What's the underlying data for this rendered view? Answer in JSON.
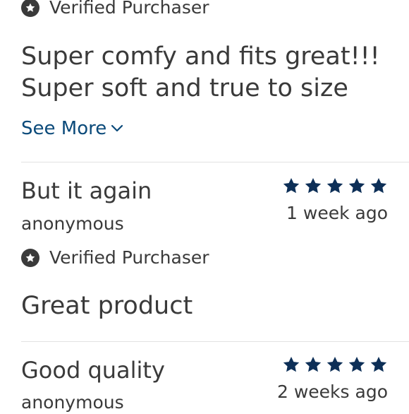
{
  "colors": {
    "text": "#3a3a3a",
    "link": "#0b4a7a",
    "star": "#0d2f57",
    "divider": "#e2e2e2"
  },
  "verified_label": "Verified Purchaser",
  "see_more_label": "See More",
  "reviews": [
    {
      "body_line1": "Super comfy and fits great!!!",
      "body_line2": "Super soft and true to size"
    },
    {
      "title": "But it again",
      "reviewer": "anonymous",
      "rating": 5,
      "date": "1 week ago",
      "body": "Great product"
    },
    {
      "title": "Good quality",
      "reviewer": "anonymous",
      "rating": 5,
      "date": "2 weeks ago"
    }
  ]
}
